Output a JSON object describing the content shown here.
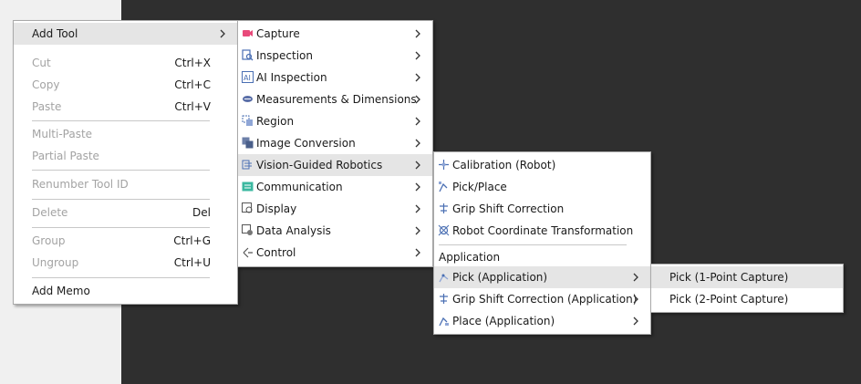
{
  "main_menu": {
    "add_tool": "Add Tool",
    "cut": "Cut",
    "cut_sc": "Ctrl+X",
    "copy": "Copy",
    "copy_sc": "Ctrl+C",
    "paste": "Paste",
    "paste_sc": "Ctrl+V",
    "multi_paste": "Multi-Paste",
    "partial_paste": "Partial Paste",
    "renumber": "Renumber Tool ID",
    "delete": "Delete",
    "delete_sc": "Del",
    "group": "Group",
    "group_sc": "Ctrl+G",
    "ungroup": "Ungroup",
    "ungroup_sc": "Ctrl+U",
    "add_memo": "Add Memo"
  },
  "tool_menu": {
    "items": [
      {
        "label": "Capture",
        "icon": "camera-icon"
      },
      {
        "label": "Inspection",
        "icon": "inspection-icon"
      },
      {
        "label": "AI Inspection",
        "icon": "ai-icon"
      },
      {
        "label": "Measurements & Dimensions",
        "icon": "measure-icon"
      },
      {
        "label": "Region",
        "icon": "region-icon"
      },
      {
        "label": "Image Conversion",
        "icon": "image-conversion-icon"
      },
      {
        "label": "Vision-Guided Robotics",
        "icon": "robotics-icon"
      },
      {
        "label": "Communication",
        "icon": "communication-icon"
      },
      {
        "label": "Display",
        "icon": "display-icon"
      },
      {
        "label": "Data Analysis",
        "icon": "data-analysis-icon"
      },
      {
        "label": "Control",
        "icon": "control-icon"
      }
    ]
  },
  "vgr_menu": {
    "calibration": "Calibration (Robot)",
    "pick_place": "Pick/Place",
    "grip_shift": "Grip Shift Correction",
    "robot_coord": "Robot Coordinate Transformation",
    "application_header": "Application",
    "pick_app": "Pick (Application)",
    "grip_shift_app": "Grip Shift Correction (Application)",
    "place_app": "Place (Application)"
  },
  "pick_menu": {
    "one_point": "Pick (1-Point Capture)",
    "two_point": "Pick (2-Point Capture)"
  },
  "colors": {
    "background": "#2f2f2f",
    "menu_bg": "#ffffff",
    "highlight": "#e5e5e5",
    "disabled_text": "#a3a3a3"
  }
}
